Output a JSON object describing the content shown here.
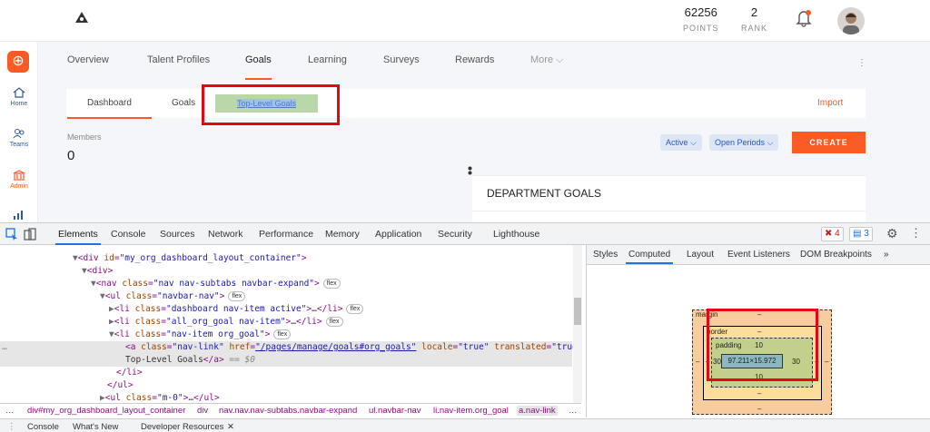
{
  "header": {
    "points_value": "62256",
    "points_label": "POINTS",
    "rank_value": "2",
    "rank_label": "RANK"
  },
  "sidebar": {
    "items": [
      {
        "label": "Home"
      },
      {
        "label": "Teams"
      },
      {
        "label": "Admin"
      }
    ]
  },
  "main_nav": {
    "tabs": [
      "Overview",
      "Talent Profiles",
      "Goals",
      "Learning",
      "Surveys",
      "Rewards",
      "More"
    ],
    "active": "Goals"
  },
  "sub_tabs": {
    "tabs": [
      "Dashboard",
      "Goals",
      "Top-Level Goals"
    ],
    "active": "Dashboard",
    "import_label": "Import"
  },
  "members": {
    "label": "Members",
    "value": "0"
  },
  "filters": {
    "status": "Active",
    "period": "Open Periods"
  },
  "create_label": "CREATE",
  "department_goals_title": "DEPARTMENT GOALS",
  "devtools": {
    "tabs": [
      "Elements",
      "Console",
      "Sources",
      "Network",
      "Performance",
      "Memory",
      "Application",
      "Security",
      "Lighthouse"
    ],
    "active_tab": "Elements",
    "error_count": "4",
    "message_count": "3",
    "dom": {
      "row0_prefix": "▼<",
      "row0_tag": "div",
      "row0_attr": "id",
      "row0_val": "\"my_org_dashboard_layout_container\"",
      "row1": "div",
      "row2_tag": "nav",
      "row2_attr": "class",
      "row2_val": "\"nav nav-subtabs navbar-expand\"",
      "row3_tag": "ul",
      "row3_attr": "class",
      "row3_val": "\"navbar-nav\"",
      "row4_val": "\"dashboard nav-item active\"",
      "row5_val": "\"all_org_goal nav-item\"",
      "row6_val": "\"nav-item org_goal\"",
      "row7_href": "\"/pages/manage/goals#org_goals\"",
      "row7_rest_attr": "locale",
      "row7_rest_val": "\"true\"",
      "row7_rest_attr2": "translated",
      "row7_rest_val2": "\"true\"",
      "row8_text": "Top-Level Goals",
      "row8_eq": "== $0",
      "row11_val": "\"m-0\"",
      "flex_badge": "flex",
      "ellipsis": "…"
    },
    "breadcrumbs": [
      "div#my_org_dashboard_layout_container",
      "div",
      "nav.nav.nav-subtabs.navbar-expand",
      "ul.navbar-nav",
      "li.nav-item.org_goal",
      "a.nav-link"
    ],
    "right_tabs": [
      "Styles",
      "Computed",
      "Layout",
      "Event Listeners",
      "DOM Breakpoints"
    ],
    "right_active": "Computed",
    "box_model": {
      "margin_label": "margin",
      "border_label": "border",
      "padding_label": "padding",
      "dash": "–",
      "padding_top": "10",
      "padding_bottom": "10",
      "padding_left": "30",
      "padding_right": "30",
      "content_size": "97.211×15.972"
    },
    "drawer_tabs": [
      "Console",
      "What's New",
      "Developer Resources"
    ]
  }
}
